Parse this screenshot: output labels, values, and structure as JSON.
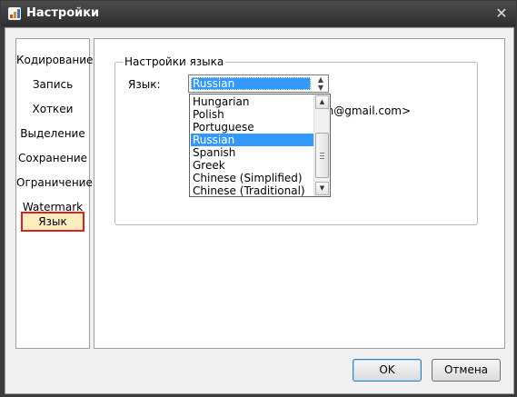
{
  "window": {
    "title": "Настройки",
    "close_glyph": "✕"
  },
  "sidebar": {
    "items": [
      {
        "label": "Кодирование"
      },
      {
        "label": "Запись"
      },
      {
        "label": "Хоткеи"
      },
      {
        "label": "Выделение"
      },
      {
        "label": "Сохранение"
      },
      {
        "label": "Ограничение"
      },
      {
        "label": "Watermark"
      },
      {
        "label": "Язык",
        "selected": true
      }
    ]
  },
  "language_group": {
    "legend": "Настройки языка",
    "label": "Язык:",
    "selected_value": "Russian",
    "options": [
      "Hungarian",
      "Polish",
      "Portuguese",
      "Russian",
      "Spanish",
      "Greek",
      "Chinese (Simplified)",
      "Chinese (Traditional)"
    ],
    "partial_text": "un@gmail.com>"
  },
  "buttons": {
    "ok": "OK",
    "cancel": "Отмена"
  },
  "colors": {
    "selection": "#3399ff",
    "sidebar_selected_border": "#e02020",
    "titlebar": "#3b3b3b"
  }
}
